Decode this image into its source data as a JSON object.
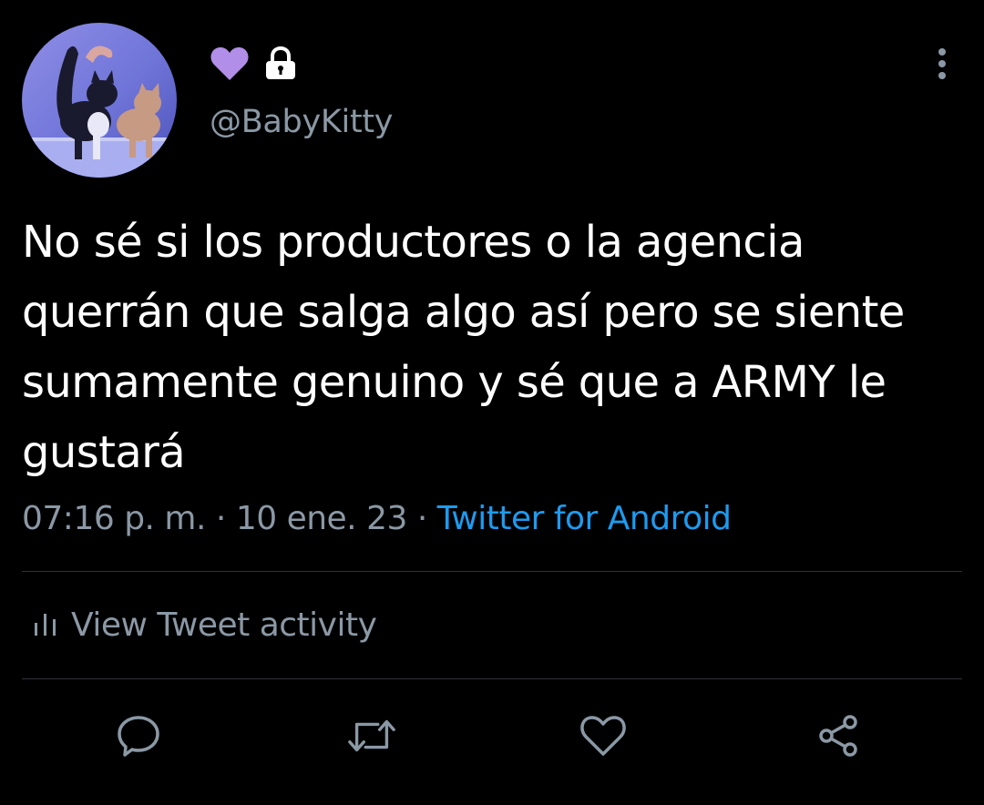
{
  "tweet": {
    "handle": "@BabyKitty",
    "name_icons": [
      "purple-heart-icon",
      "lock-icon"
    ],
    "text": "No sé si los productores o la agencia querrán que salga algo así pero se siente sumamente genuino y sé que a ARMY le gustará",
    "time": "07:16 p. m.",
    "separator": "·",
    "date": "10 ene. 23",
    "source": "Twitter for Android"
  },
  "activity": {
    "label": "View Tweet activity",
    "icon": "bar-chart-icon"
  },
  "actions": [
    "reply-icon",
    "retweet-icon",
    "like-icon",
    "share-icon"
  ],
  "colors": {
    "background": "#000000",
    "text": "#ffffff",
    "muted": "#8b98a5",
    "accent": "#1d9bf0",
    "heart": "#b18ee8",
    "divider": "#2f3336"
  }
}
